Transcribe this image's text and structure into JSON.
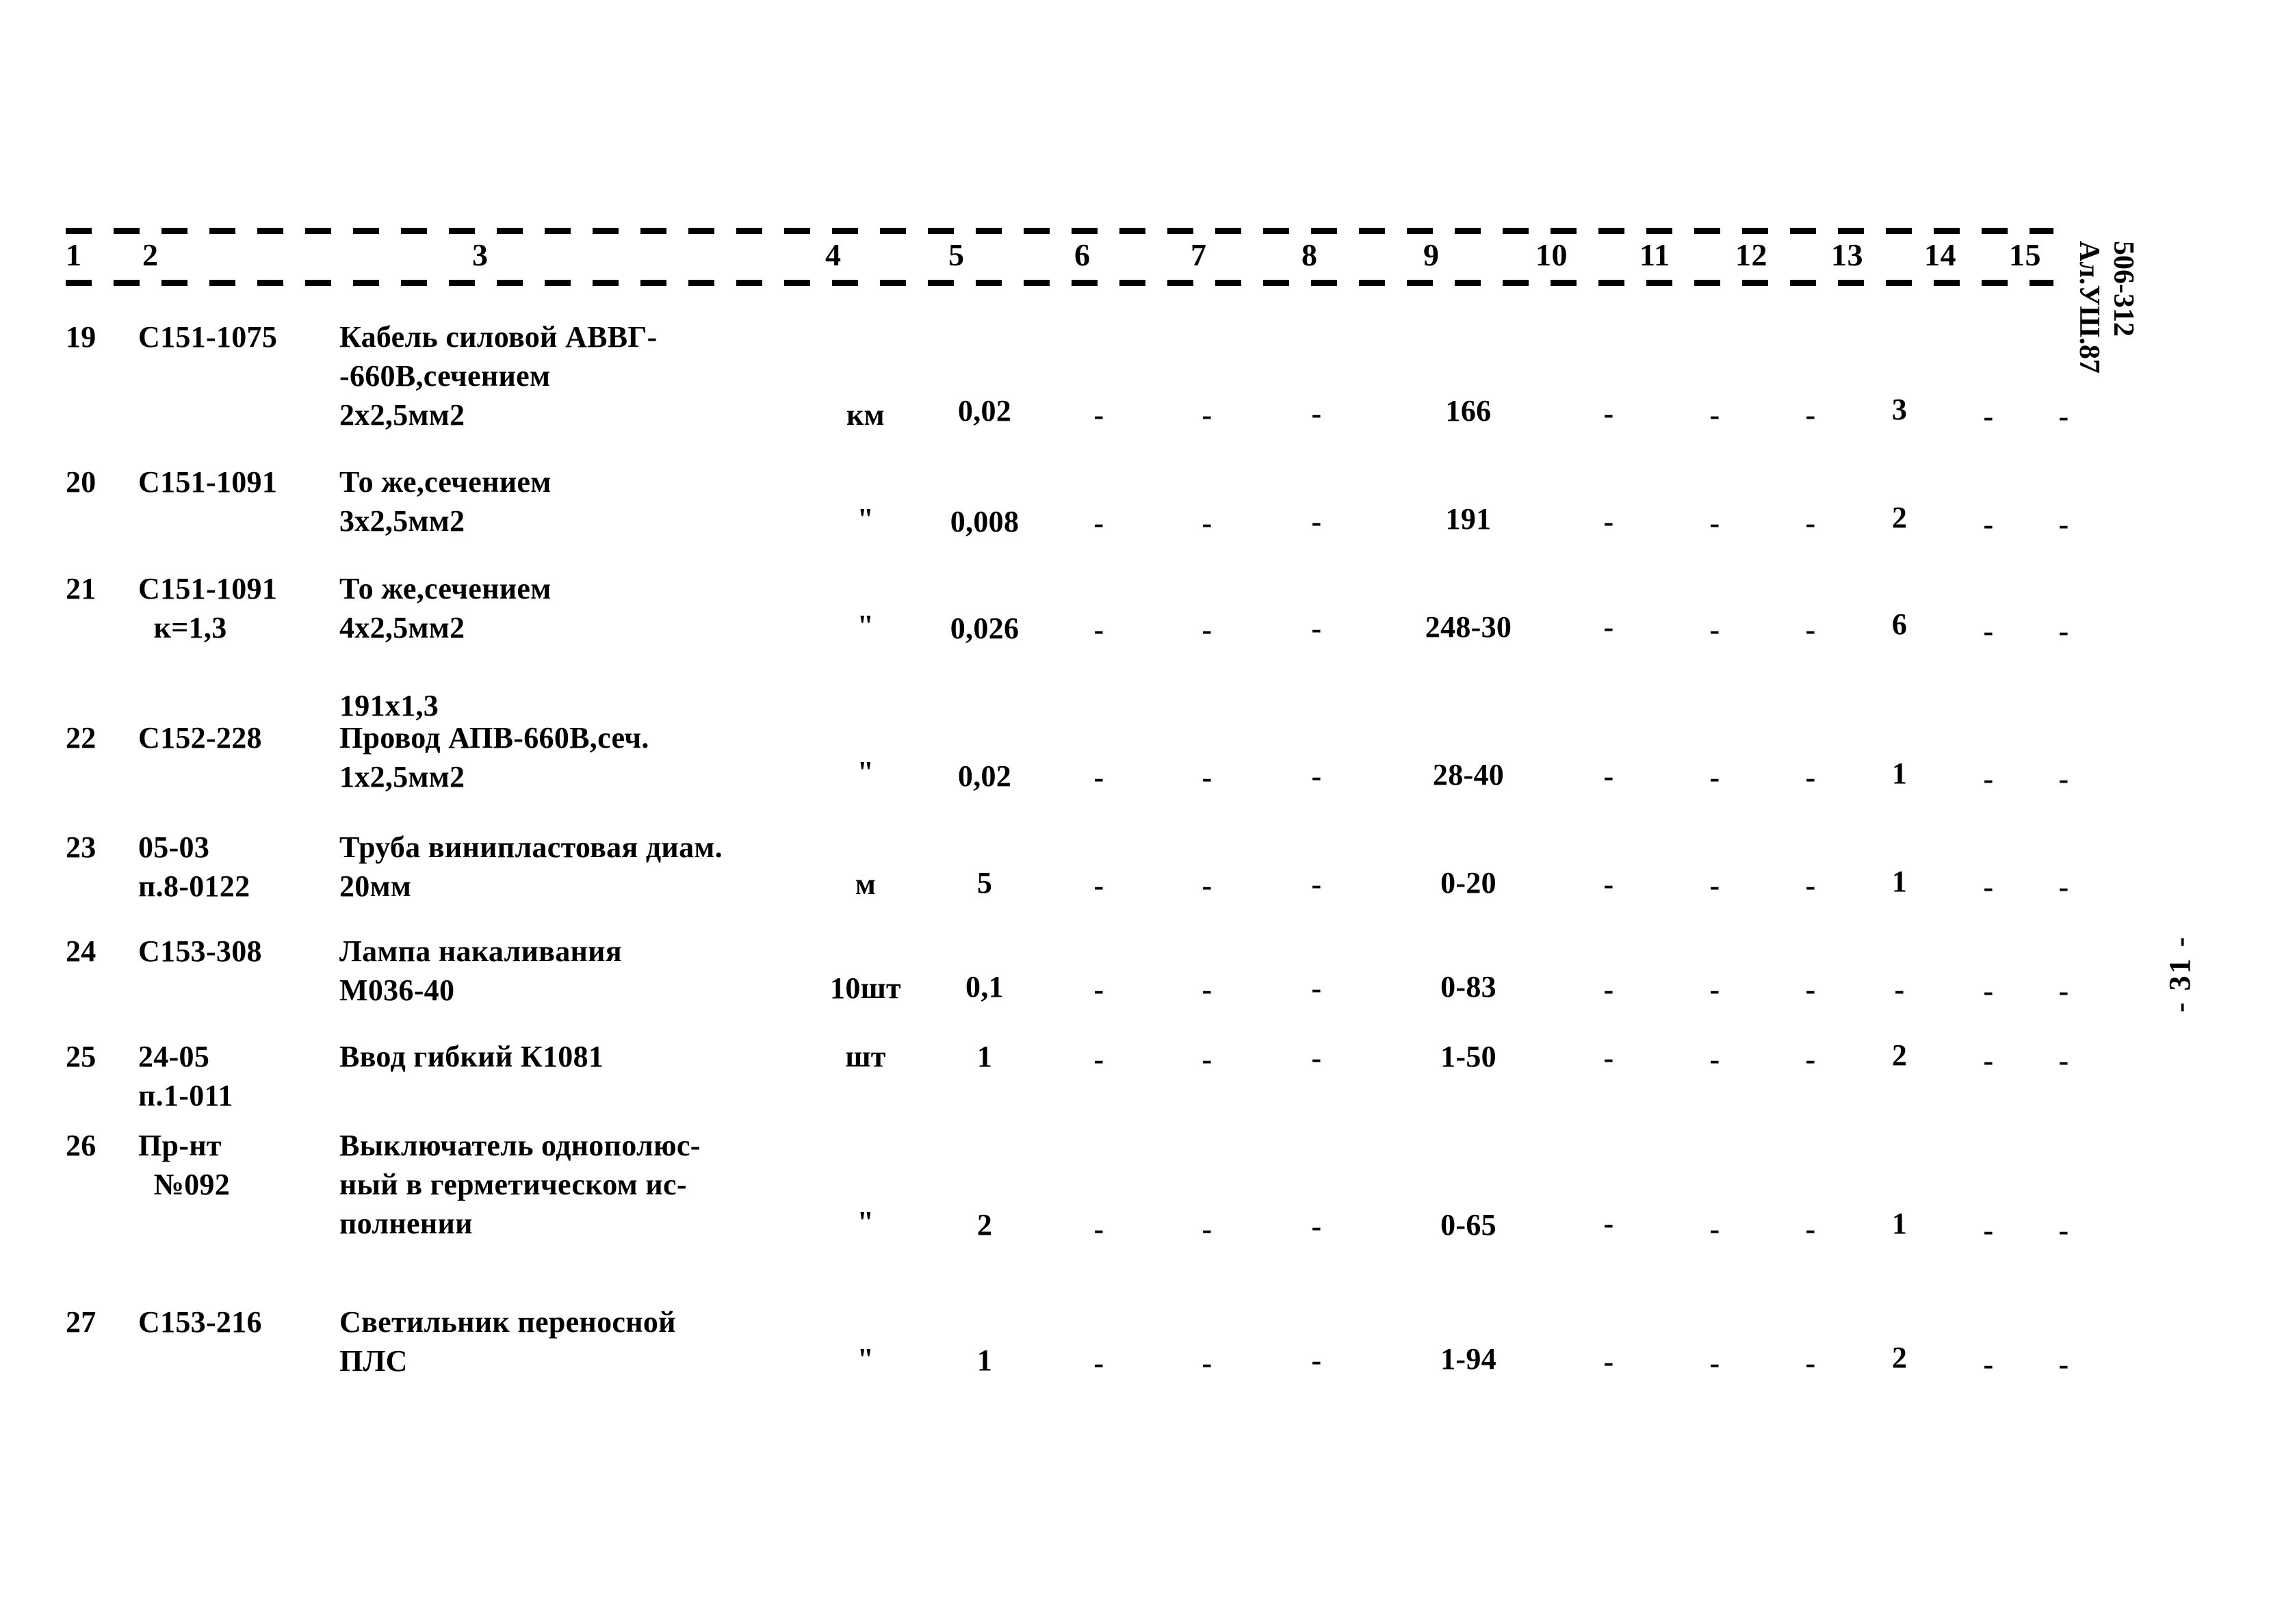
{
  "document": {
    "type": "scanned-typewritten-estimate-table",
    "stamp_code_line1": "506-312",
    "stamp_code_line2": "Ал.УШ.87",
    "page_marker": "- 31 -"
  },
  "table": {
    "column_numbers": [
      "1",
      "2",
      "3",
      "4",
      "5",
      "6",
      "7",
      "8",
      "9",
      "10",
      "11",
      "12",
      "13",
      "14",
      "15"
    ],
    "rows": [
      {
        "num": "19",
        "code": "С151-1075",
        "name": "Кабель силовой АВВГ-\n-660В,сечением\n2х2,5мм2",
        "c4": "км",
        "c5": "0,02",
        "c6": "-",
        "c7": "-",
        "c8": "-",
        "c9": "166",
        "c10": "-",
        "c11": "-",
        "c12": "-",
        "c13": "3",
        "c14": "-",
        "c15": "-"
      },
      {
        "num": "20",
        "code": "С151-1091",
        "name": "То же,сечением\n3х2,5мм2",
        "c4": "\"",
        "c5": "0,008",
        "c6": "-",
        "c7": "-",
        "c8": "-",
        "c9": "191",
        "c10": "-",
        "c11": "-",
        "c12": "-",
        "c13": "2",
        "c14": "-",
        "c15": "-"
      },
      {
        "num": "21",
        "code": "С151-1091\n  к=1,3",
        "name": "То же,сечением\n4х2,5мм2\n\n191х1,3",
        "c4": "\"",
        "c5": "0,026",
        "c6": "-",
        "c7": "-",
        "c8": "-",
        "c9": "248-30",
        "c10": "-",
        "c11": "-",
        "c12": "-",
        "c13": "6",
        "c14": "-",
        "c15": "-"
      },
      {
        "num": "22",
        "code": "С152-228",
        "name": "Провод АПВ-660В,сеч.\n1х2,5мм2",
        "c4": "\"",
        "c5": "0,02",
        "c6": "-",
        "c7": "-",
        "c8": "-",
        "c9": "28-40",
        "c10": "-",
        "c11": "-",
        "c12": "-",
        "c13": "1",
        "c14": "-",
        "c15": "-"
      },
      {
        "num": "23",
        "code": "05-03\nп.8-0122",
        "name": "Труба винипластовая диам.\n20мм",
        "c4": "м",
        "c5": "5",
        "c6": "-",
        "c7": "-",
        "c8": "-",
        "c9": "0-20",
        "c10": "-",
        "c11": "-",
        "c12": "-",
        "c13": "1",
        "c14": "-",
        "c15": "-"
      },
      {
        "num": "24",
        "code": "С153-308",
        "name": "Лампа накаливания\nМ036-40",
        "c4": "10шт",
        "c5": "0,1",
        "c6": "-",
        "c7": "-",
        "c8": "-",
        "c9": "0-83",
        "c10": "-",
        "c11": "-",
        "c12": "-",
        "c13": "-",
        "c14": "-",
        "c15": "-"
      },
      {
        "num": "25",
        "code": "24-05\nп.1-011",
        "name": "Ввод гибкий К1081",
        "c4": "шт",
        "c5": "1",
        "c6": "-",
        "c7": "-",
        "c8": "-",
        "c9": "1-50",
        "c10": "-",
        "c11": "-",
        "c12": "-",
        "c13": "2",
        "c14": "-",
        "c15": "-"
      },
      {
        "num": "26",
        "code": "Пр-нт\n  №092",
        "name": "Выключатель однополюс-\nный в герметическом ис-\nполнении",
        "c4": "\"",
        "c5": "2",
        "c6": "-",
        "c7": "-",
        "c8": "-",
        "c9": "0-65",
        "c10": "-",
        "c11": "-",
        "c12": "-",
        "c13": "1",
        "c14": "-",
        "c15": "-"
      },
      {
        "num": "27",
        "code": "С153-216",
        "name": "Светильник переносной\nПЛС",
        "c4": "\"",
        "c5": "1",
        "c6": "-",
        "c7": "-",
        "c8": "-",
        "c9": "1-94",
        "c10": "-",
        "c11": "-",
        "c12": "-",
        "c13": "2",
        "c14": "-",
        "c15": "-"
      }
    ]
  }
}
